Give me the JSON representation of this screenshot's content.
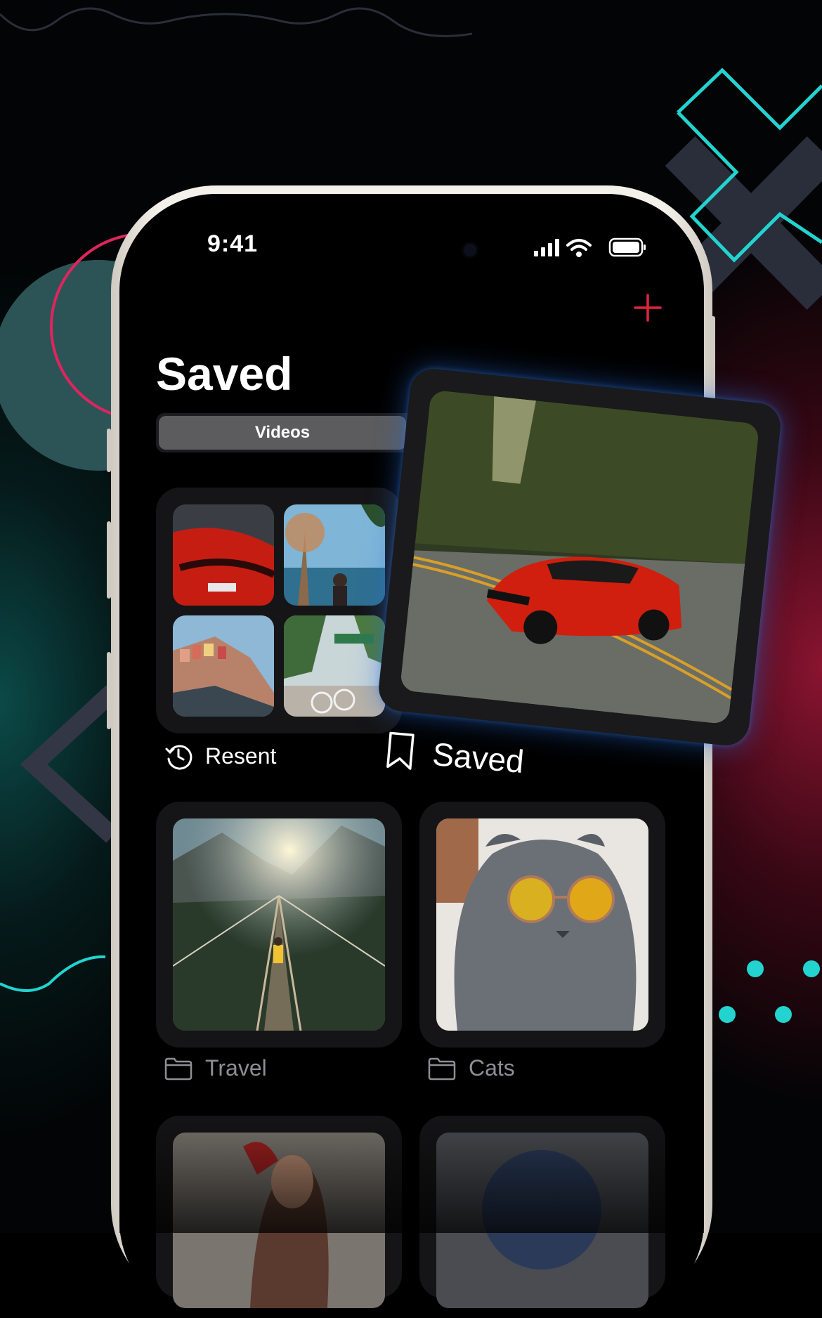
{
  "status_bar": {
    "time": "9:41"
  },
  "header": {
    "title": "Saved",
    "add_icon": "plus-icon"
  },
  "segmented_control": {
    "active_label": "Videos"
  },
  "collections": [
    {
      "label": "Resent",
      "icon": "clock-history-icon"
    },
    {
      "label": "Travel",
      "icon": "folder-icon"
    },
    {
      "label": "Cats",
      "icon": "folder-icon"
    }
  ],
  "floating_card": {
    "label": "Saved",
    "icon": "bookmark-icon"
  },
  "colors": {
    "accent": "#e0243e",
    "teal_decor": "#23d3d0",
    "pink_decor": "#e0245e",
    "card_bg": "#151517",
    "muted_text": "#8e8e93"
  }
}
